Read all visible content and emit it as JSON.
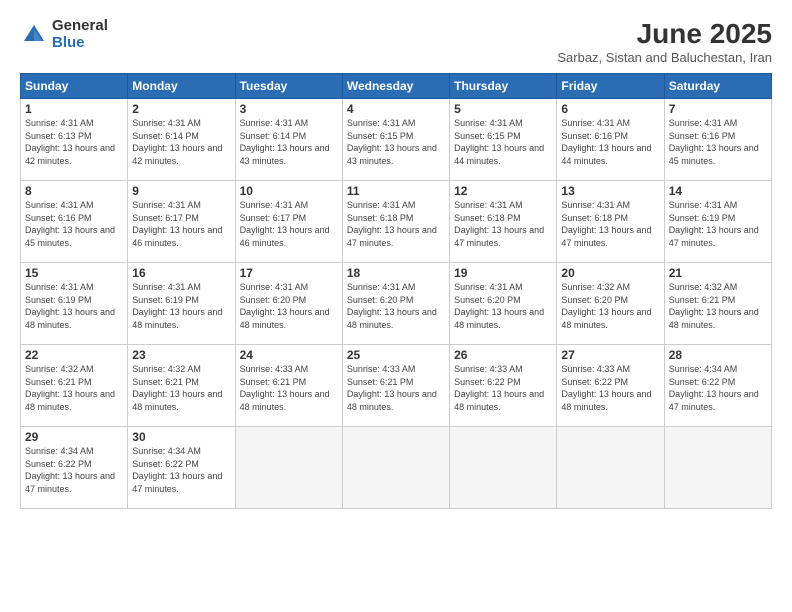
{
  "logo": {
    "general": "General",
    "blue": "Blue"
  },
  "title": "June 2025",
  "subtitle": "Sarbaz, Sistan and Baluchestan, Iran",
  "weekdays": [
    "Sunday",
    "Monday",
    "Tuesday",
    "Wednesday",
    "Thursday",
    "Friday",
    "Saturday"
  ],
  "weeks": [
    [
      {
        "day": "1",
        "sunrise": "Sunrise: 4:31 AM",
        "sunset": "Sunset: 6:13 PM",
        "daylight": "Daylight: 13 hours and 42 minutes."
      },
      {
        "day": "2",
        "sunrise": "Sunrise: 4:31 AM",
        "sunset": "Sunset: 6:14 PM",
        "daylight": "Daylight: 13 hours and 42 minutes."
      },
      {
        "day": "3",
        "sunrise": "Sunrise: 4:31 AM",
        "sunset": "Sunset: 6:14 PM",
        "daylight": "Daylight: 13 hours and 43 minutes."
      },
      {
        "day": "4",
        "sunrise": "Sunrise: 4:31 AM",
        "sunset": "Sunset: 6:15 PM",
        "daylight": "Daylight: 13 hours and 43 minutes."
      },
      {
        "day": "5",
        "sunrise": "Sunrise: 4:31 AM",
        "sunset": "Sunset: 6:15 PM",
        "daylight": "Daylight: 13 hours and 44 minutes."
      },
      {
        "day": "6",
        "sunrise": "Sunrise: 4:31 AM",
        "sunset": "Sunset: 6:16 PM",
        "daylight": "Daylight: 13 hours and 44 minutes."
      },
      {
        "day": "7",
        "sunrise": "Sunrise: 4:31 AM",
        "sunset": "Sunset: 6:16 PM",
        "daylight": "Daylight: 13 hours and 45 minutes."
      }
    ],
    [
      {
        "day": "8",
        "sunrise": "Sunrise: 4:31 AM",
        "sunset": "Sunset: 6:16 PM",
        "daylight": "Daylight: 13 hours and 45 minutes."
      },
      {
        "day": "9",
        "sunrise": "Sunrise: 4:31 AM",
        "sunset": "Sunset: 6:17 PM",
        "daylight": "Daylight: 13 hours and 46 minutes."
      },
      {
        "day": "10",
        "sunrise": "Sunrise: 4:31 AM",
        "sunset": "Sunset: 6:17 PM",
        "daylight": "Daylight: 13 hours and 46 minutes."
      },
      {
        "day": "11",
        "sunrise": "Sunrise: 4:31 AM",
        "sunset": "Sunset: 6:18 PM",
        "daylight": "Daylight: 13 hours and 47 minutes."
      },
      {
        "day": "12",
        "sunrise": "Sunrise: 4:31 AM",
        "sunset": "Sunset: 6:18 PM",
        "daylight": "Daylight: 13 hours and 47 minutes."
      },
      {
        "day": "13",
        "sunrise": "Sunrise: 4:31 AM",
        "sunset": "Sunset: 6:18 PM",
        "daylight": "Daylight: 13 hours and 47 minutes."
      },
      {
        "day": "14",
        "sunrise": "Sunrise: 4:31 AM",
        "sunset": "Sunset: 6:19 PM",
        "daylight": "Daylight: 13 hours and 47 minutes."
      }
    ],
    [
      {
        "day": "15",
        "sunrise": "Sunrise: 4:31 AM",
        "sunset": "Sunset: 6:19 PM",
        "daylight": "Daylight: 13 hours and 48 minutes."
      },
      {
        "day": "16",
        "sunrise": "Sunrise: 4:31 AM",
        "sunset": "Sunset: 6:19 PM",
        "daylight": "Daylight: 13 hours and 48 minutes."
      },
      {
        "day": "17",
        "sunrise": "Sunrise: 4:31 AM",
        "sunset": "Sunset: 6:20 PM",
        "daylight": "Daylight: 13 hours and 48 minutes."
      },
      {
        "day": "18",
        "sunrise": "Sunrise: 4:31 AM",
        "sunset": "Sunset: 6:20 PM",
        "daylight": "Daylight: 13 hours and 48 minutes."
      },
      {
        "day": "19",
        "sunrise": "Sunrise: 4:31 AM",
        "sunset": "Sunset: 6:20 PM",
        "daylight": "Daylight: 13 hours and 48 minutes."
      },
      {
        "day": "20",
        "sunrise": "Sunrise: 4:32 AM",
        "sunset": "Sunset: 6:20 PM",
        "daylight": "Daylight: 13 hours and 48 minutes."
      },
      {
        "day": "21",
        "sunrise": "Sunrise: 4:32 AM",
        "sunset": "Sunset: 6:21 PM",
        "daylight": "Daylight: 13 hours and 48 minutes."
      }
    ],
    [
      {
        "day": "22",
        "sunrise": "Sunrise: 4:32 AM",
        "sunset": "Sunset: 6:21 PM",
        "daylight": "Daylight: 13 hours and 48 minutes."
      },
      {
        "day": "23",
        "sunrise": "Sunrise: 4:32 AM",
        "sunset": "Sunset: 6:21 PM",
        "daylight": "Daylight: 13 hours and 48 minutes."
      },
      {
        "day": "24",
        "sunrise": "Sunrise: 4:33 AM",
        "sunset": "Sunset: 6:21 PM",
        "daylight": "Daylight: 13 hours and 48 minutes."
      },
      {
        "day": "25",
        "sunrise": "Sunrise: 4:33 AM",
        "sunset": "Sunset: 6:21 PM",
        "daylight": "Daylight: 13 hours and 48 minutes."
      },
      {
        "day": "26",
        "sunrise": "Sunrise: 4:33 AM",
        "sunset": "Sunset: 6:22 PM",
        "daylight": "Daylight: 13 hours and 48 minutes."
      },
      {
        "day": "27",
        "sunrise": "Sunrise: 4:33 AM",
        "sunset": "Sunset: 6:22 PM",
        "daylight": "Daylight: 13 hours and 48 minutes."
      },
      {
        "day": "28",
        "sunrise": "Sunrise: 4:34 AM",
        "sunset": "Sunset: 6:22 PM",
        "daylight": "Daylight: 13 hours and 47 minutes."
      }
    ],
    [
      {
        "day": "29",
        "sunrise": "Sunrise: 4:34 AM",
        "sunset": "Sunset: 6:22 PM",
        "daylight": "Daylight: 13 hours and 47 minutes."
      },
      {
        "day": "30",
        "sunrise": "Sunrise: 4:34 AM",
        "sunset": "Sunset: 6:22 PM",
        "daylight": "Daylight: 13 hours and 47 minutes."
      },
      {
        "day": "",
        "sunrise": "",
        "sunset": "",
        "daylight": ""
      },
      {
        "day": "",
        "sunrise": "",
        "sunset": "",
        "daylight": ""
      },
      {
        "day": "",
        "sunrise": "",
        "sunset": "",
        "daylight": ""
      },
      {
        "day": "",
        "sunrise": "",
        "sunset": "",
        "daylight": ""
      },
      {
        "day": "",
        "sunrise": "",
        "sunset": "",
        "daylight": ""
      }
    ]
  ]
}
